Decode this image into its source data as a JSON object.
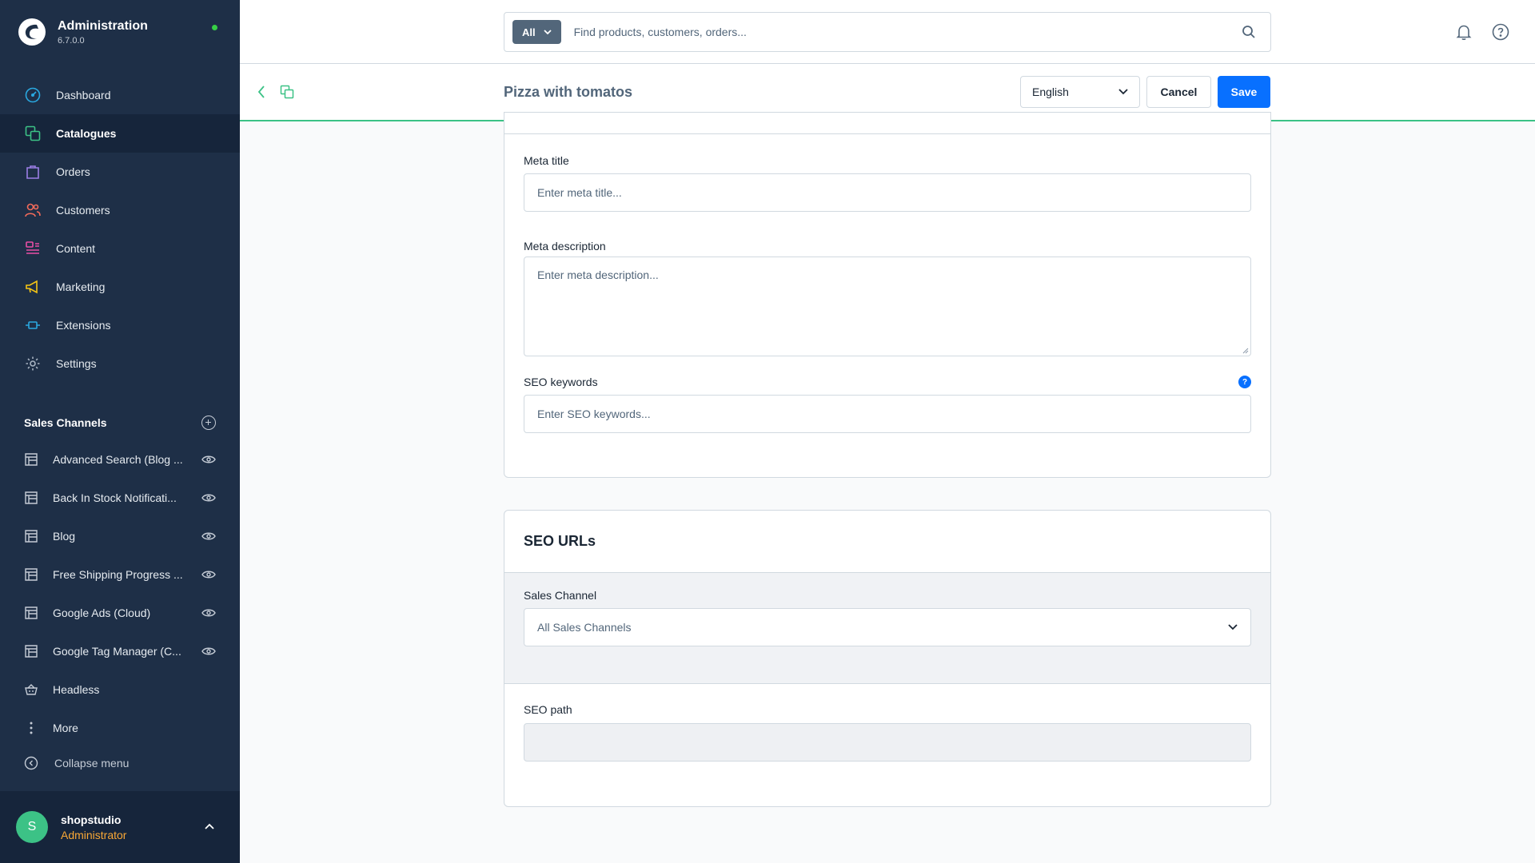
{
  "brand": {
    "title": "Administration",
    "version": "6.7.0.0"
  },
  "nav": {
    "items": [
      {
        "label": "Dashboard",
        "icon": "dashboard-icon"
      },
      {
        "label": "Catalogues",
        "icon": "catalogue-icon",
        "active": true
      },
      {
        "label": "Orders",
        "icon": "orders-icon"
      },
      {
        "label": "Customers",
        "icon": "customers-icon"
      },
      {
        "label": "Content",
        "icon": "content-icon"
      },
      {
        "label": "Marketing",
        "icon": "marketing-icon"
      },
      {
        "label": "Extensions",
        "icon": "extensions-icon"
      },
      {
        "label": "Settings",
        "icon": "settings-icon"
      }
    ]
  },
  "sales_channels": {
    "title": "Sales Channels",
    "items": [
      {
        "label": "Advanced Search (Blog ..."
      },
      {
        "label": "Back In Stock Notificati..."
      },
      {
        "label": "Blog"
      },
      {
        "label": "Free Shipping Progress ..."
      },
      {
        "label": "Google Ads (Cloud)"
      },
      {
        "label": "Google Tag Manager (C..."
      },
      {
        "label": "Headless"
      },
      {
        "label": "More"
      }
    ],
    "collapse_label": "Collapse menu"
  },
  "user": {
    "initial": "S",
    "name": "shopstudio",
    "role": "Administrator"
  },
  "search": {
    "type_label": "All",
    "placeholder": "Find products, customers, orders..."
  },
  "smartbar": {
    "title": "Pizza with tomatos",
    "language": "English",
    "cancel_label": "Cancel",
    "save_label": "Save"
  },
  "seo": {
    "meta_title_label": "Meta title",
    "meta_title_placeholder": "Enter meta title...",
    "meta_description_label": "Meta description",
    "meta_description_placeholder": "Enter meta description...",
    "keywords_label": "SEO keywords",
    "keywords_placeholder": "Enter SEO keywords...",
    "help_glyph": "?"
  },
  "seo_urls": {
    "title": "SEO URLs",
    "sales_channel_label": "Sales Channel",
    "sales_channel_value": "All Sales Channels",
    "seo_path_label": "SEO path",
    "seo_path_value": ""
  },
  "colors": {
    "sidebar": "#1e2f47",
    "sidebar_active": "#16253b",
    "primary": "#0870ff",
    "accent_green": "#3cc286",
    "role_orange": "#f9a836"
  }
}
